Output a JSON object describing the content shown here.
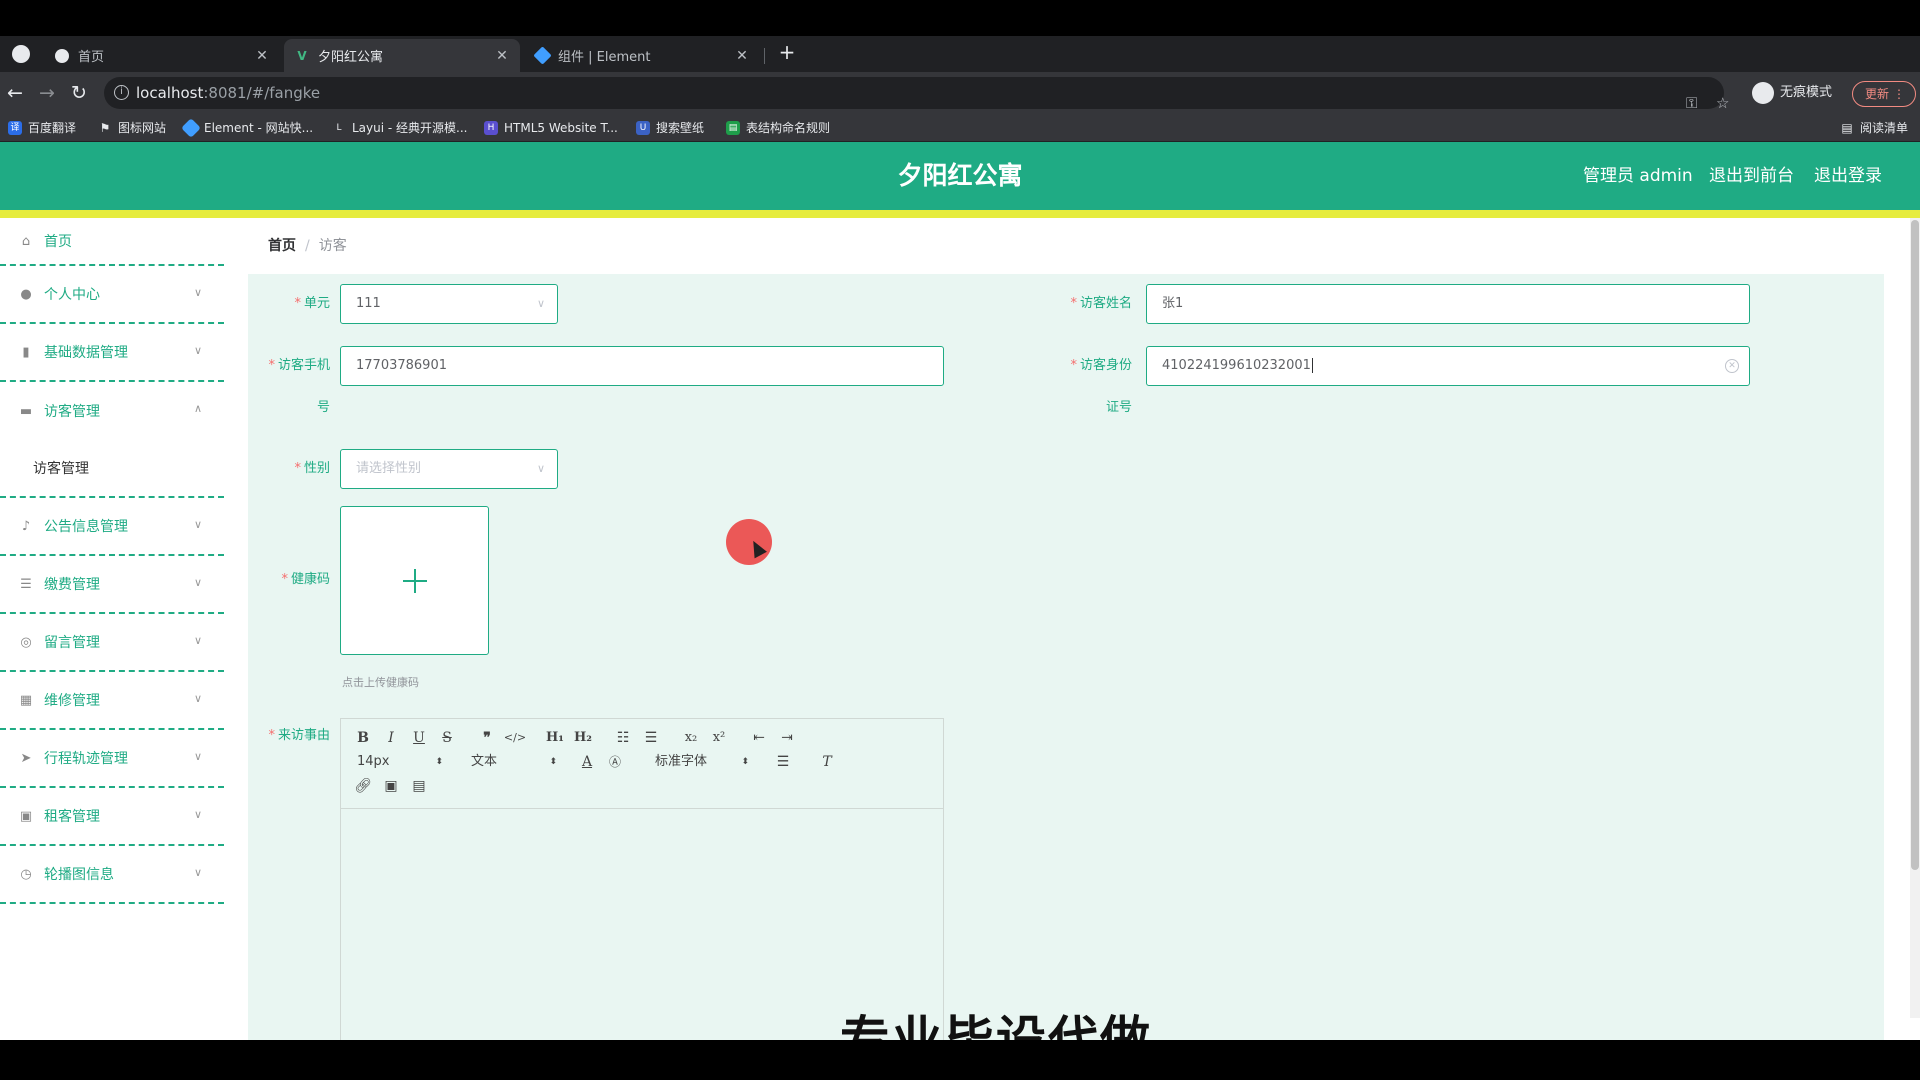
{
  "browser": {
    "tabs": [
      {
        "title": "首页",
        "icon": "globe-icon"
      },
      {
        "title": "夕阳红公寓",
        "icon": "vue-icon"
      },
      {
        "title": "组件 | Element",
        "icon": "element-icon"
      }
    ],
    "address": {
      "host": "localhost",
      "path": ":8081/#/fangke"
    },
    "incognito_label": "无痕模式",
    "update_label": "更新",
    "bookmarks": [
      "百度翻译",
      "图标网站",
      "Element - 网站快...",
      "Layui - 经典开源模...",
      "HTML5 Website T...",
      "搜索壁纸",
      "表结构命名规则"
    ],
    "reading_list": "阅读清单"
  },
  "header": {
    "title": "夕阳红公寓",
    "admin": "管理员 admin",
    "front": "退出到前台",
    "logout": "退出登录",
    "brand_color": "#1fab84",
    "strip_color": "#e6ec3e"
  },
  "sidebar": {
    "items": [
      {
        "label": "首页",
        "icon": "home-icon"
      },
      {
        "label": "个人中心",
        "icon": "user-icon"
      },
      {
        "label": "基础数据管理",
        "icon": "chart-icon"
      },
      {
        "label": "访客管理",
        "icon": "monitor-icon"
      },
      {
        "label": "公告信息管理",
        "icon": "microphone-icon"
      },
      {
        "label": "缴费管理",
        "icon": "sliders-icon"
      },
      {
        "label": "留言管理",
        "icon": "globe-icon"
      },
      {
        "label": "维修管理",
        "icon": "grid-icon"
      },
      {
        "label": "行程轨迹管理",
        "icon": "navigation-icon"
      },
      {
        "label": "租客管理",
        "icon": "clipboard-icon"
      },
      {
        "label": "轮播图信息",
        "icon": "clock-icon"
      }
    ],
    "sub_item": "访客管理"
  },
  "breadcrumb": {
    "home": "首页",
    "sep": "/",
    "current": "访客"
  },
  "form": {
    "unit": {
      "label": "单元",
      "value": "111"
    },
    "visitor_name": {
      "label": "访客姓名",
      "value": "张1"
    },
    "phone": {
      "label_line1": "访客手机",
      "label_line2": "号",
      "value": "17703786901"
    },
    "id_number": {
      "label_line1": "访客身份",
      "label_line2": "证号",
      "value": "410224199610232001"
    },
    "gender": {
      "label": "性别",
      "placeholder": "请选择性别"
    },
    "health_code": {
      "label": "健康码",
      "tip": "点击上传健康码"
    },
    "reason": {
      "label": "来访事由"
    },
    "required_mark": "*"
  },
  "editor": {
    "font_size": "14px",
    "block_type": "文本",
    "font_family": "标准字体"
  },
  "overlay_caption": "专业毕设代做"
}
